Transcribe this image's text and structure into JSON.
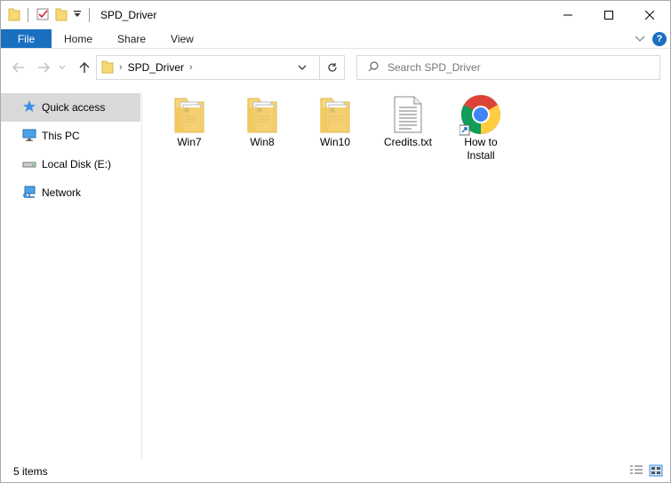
{
  "window": {
    "title": "SPD_Driver"
  },
  "ribbon": {
    "tabs": [
      "File",
      "Home",
      "Share",
      "View"
    ]
  },
  "nav": {
    "address_path": "SPD_Driver",
    "search_placeholder": "Search SPD_Driver"
  },
  "sidebar": {
    "items": [
      {
        "label": "Quick access",
        "icon": "star-icon"
      },
      {
        "label": "This PC",
        "icon": "computer-icon"
      },
      {
        "label": "Local Disk (E:)",
        "icon": "drive-icon"
      },
      {
        "label": "Network",
        "icon": "network-icon"
      }
    ],
    "selected_index": 0
  },
  "files": [
    {
      "name": "Win7",
      "icon": "folder-icon"
    },
    {
      "name": "Win8",
      "icon": "folder-icon"
    },
    {
      "name": "Win10",
      "icon": "folder-icon"
    },
    {
      "name": "Credits.txt",
      "icon": "text-file-icon"
    },
    {
      "name": "How to Install",
      "icon": "chrome-shortcut-icon"
    }
  ],
  "status": {
    "item_count": "5 items"
  },
  "colors": {
    "accent": "#1a6fc1",
    "selected_bg": "#d9d9d9",
    "folder_yellow": "#f8d775"
  }
}
